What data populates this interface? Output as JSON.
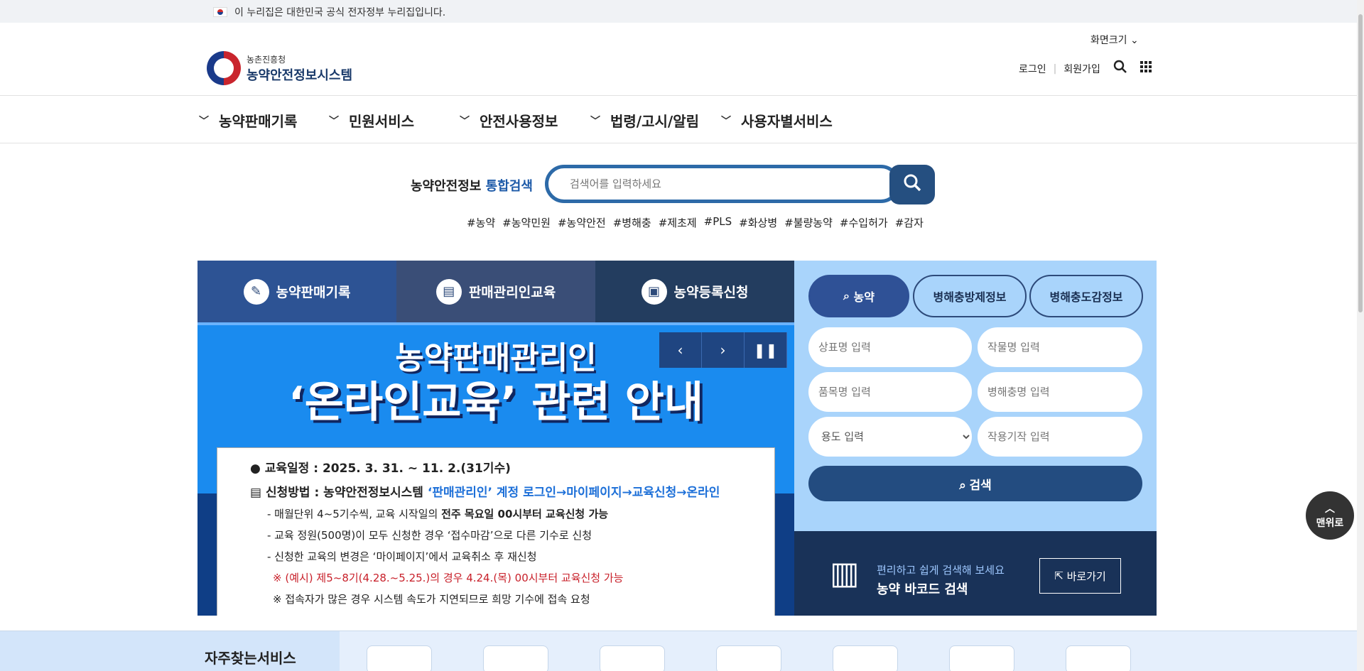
{
  "gov_bar": {
    "text": "이 누리집은 대한민국 공식 전자정부 누리집입니다."
  },
  "header": {
    "org": "농촌진흥청",
    "site_name": "농약안전정보시스템",
    "font_size_label": "화면크기",
    "login": "로그인",
    "signup": "회원가입"
  },
  "nav": [
    "농약판매기록",
    "민원서비스",
    "안전사용정보",
    "법령/고시/알림",
    "사용자별서비스"
  ],
  "search": {
    "title_prefix": "농약안전정보",
    "title_accent": "통합검색",
    "placeholder": "검색어를 입력하세요",
    "tags": [
      "#농약",
      "#농약민원",
      "#농약안전",
      "#병해충",
      "#제초제",
      "#PLS",
      "#화상병",
      "#불량농약",
      "#수입허가",
      "#감자"
    ]
  },
  "hero": {
    "tabs": [
      "농약판매기록",
      "판매관리인교육",
      "농약등록신청"
    ],
    "banner_line1": "농약판매관리인",
    "banner_line2": "‘온라인교육’ 관련 안내",
    "edu_date": "교육일정 : 2025. 3. 31. ~ 11. 2.(31기수)",
    "apply_prefix": "신청방법 : 농약안전정보시스템 ",
    "apply_accent": "‘판매관리인’ 계정 로그인→마이페이지→교육신청→온라인",
    "line_a_pre": "- 매월단위 4~5기수씩, 교육 시작일의 ",
    "line_a_bold": "전주 목요일 00시부터 교육신청 가능",
    "line_b": "- 교육 정원(500명)이 모두 신청한 경우 ‘접수마감’으로 다른 기수로 신청",
    "line_c": "- 신청한 교육의 변경은 ‘마이페이지’에서 교육취소 후 재신청",
    "note_red": "※ (예시) 제5~8기(4.28.~5.25.)의 경우 4.24.(목) 00시부터 교육신청 가능",
    "note": "※ 접속자가 많은 경우 시스템 속도가 지연되므로 희망 기수에 접속 요청"
  },
  "side": {
    "tab_active": "농약",
    "tab2": "병해충방제정보",
    "tab3": "병해충도감정보",
    "brand_ph": "상표명 입력",
    "crop_ph": "작물명 입력",
    "item_ph": "품목명 입력",
    "pest_ph": "병해충명 입력",
    "usage_selected": "용도 입력",
    "mech_ph": "작용기작 입력",
    "search_btn": "검색",
    "barcode_t1": "편리하고 쉽게 검색해 보세요",
    "barcode_t2": "농약 바코드 검색",
    "barcode_go": "바로가기"
  },
  "freq": {
    "title": "자주찾는서비스"
  },
  "top_btn": "맨위로"
}
